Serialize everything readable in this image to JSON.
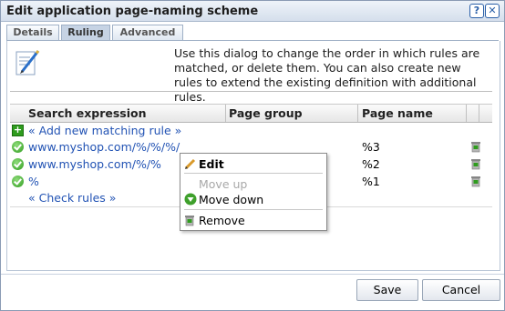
{
  "dialog": {
    "title": "Edit application page-naming scheme",
    "help_icon": "help-icon",
    "close_icon": "close-icon"
  },
  "tabs": [
    {
      "label": "Details",
      "active": false
    },
    {
      "label": "Ruling",
      "active": true
    },
    {
      "label": "Advanced",
      "active": false
    }
  ],
  "description": "Use this dialog to change the order in which rules are matched, or delete them. You can also create new rules to extend the existing definition with additional rules.",
  "grid": {
    "columns": [
      "Search expression",
      "Page group",
      "Page name"
    ],
    "add_rule_label": "« Add new matching rule »",
    "rows": [
      {
        "search": "www.myshop.com/%/%/%/",
        "page_group": "",
        "page_name": "%3"
      },
      {
        "search": "www.myshop.com/%/%",
        "page_group": "",
        "page_name": "%2"
      },
      {
        "search": "%",
        "page_group": "",
        "page_name": "%1"
      }
    ],
    "check_rules_label": "« Check rules »"
  },
  "context_menu": {
    "items": [
      {
        "label": "Edit",
        "enabled": true,
        "icon": "pencil-icon"
      },
      {
        "label": "Move up",
        "enabled": false
      },
      {
        "label": "Move down",
        "enabled": true,
        "icon": "arrow-down-icon"
      },
      {
        "label": "Remove",
        "enabled": true,
        "icon": "trash-icon"
      }
    ]
  },
  "buttons": {
    "save": "Save",
    "cancel": "Cancel"
  },
  "colors": {
    "link": "#2253b4",
    "accent": "#2a5fa8",
    "ok_green": "#2f9c1e"
  }
}
